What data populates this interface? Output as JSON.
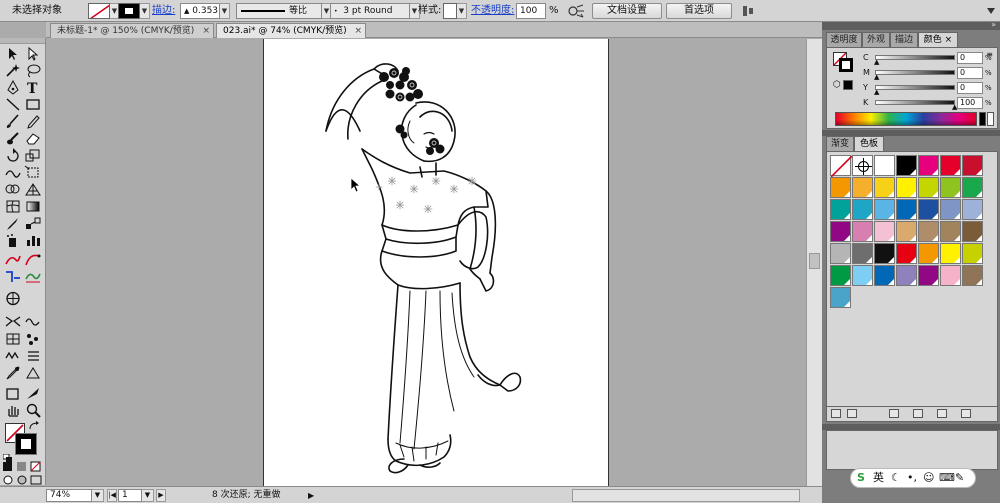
{
  "control_bar": {
    "selection_label": "未选择对象",
    "stroke_label": "描边:",
    "stroke_weight": "0.353",
    "stroke_profile": "等比",
    "brush": "3 pt Round",
    "style_label": "样式:",
    "opacity_label": "不透明度:",
    "opacity_value": "100",
    "opacity_unit": "%",
    "doc_setup_button": "文档设置",
    "preferences_button": "首选项"
  },
  "tabs": [
    {
      "label": "未标题-1* @ 150% (CMYK/预览)",
      "close": "×",
      "active": false
    },
    {
      "label": "023.ai* @ 74% (CMYK/预览)",
      "close": "×",
      "active": true
    }
  ],
  "status_bar": {
    "zoom": "74%",
    "artboard_number": "1",
    "undo_info": "8 次还原; 无重做"
  },
  "color_panel": {
    "tabs": [
      "透明度",
      "外观",
      "描边",
      "颜色"
    ],
    "active_tab": "颜色",
    "channels": [
      {
        "name": "C",
        "value": "0",
        "unit": "%"
      },
      {
        "name": "M",
        "value": "0",
        "unit": "%"
      },
      {
        "name": "Y",
        "value": "0",
        "unit": "%"
      },
      {
        "name": "K",
        "value": "100",
        "unit": "%"
      }
    ]
  },
  "swatch_panel": {
    "tabs": [
      "渐变",
      "色板"
    ],
    "active_tab": "色板",
    "swatches": [
      "none",
      "registration",
      "#ffffff",
      "#000000",
      "#e6007e",
      "#e4002b",
      "#c8102e",
      "#f39800",
      "#f6ae2d",
      "#f7d117",
      "#fff100",
      "#c3d600",
      "#8fc31f",
      "#1aa84d",
      "#00a29a",
      "#1fa5c6",
      "#5ab4e5",
      "#0068b7",
      "#1e50a2",
      "#7e95c6",
      "#9db1d9",
      "#920783",
      "#d67fb0",
      "#f4c0d4",
      "#d9a96d",
      "#b08d6a",
      "#a1845c",
      "#7a5c38",
      "#b5b5b5",
      "#6e6e6e",
      "#111111",
      "#e60012",
      "#f39800",
      "#fff100",
      "#c7d100",
      "#009944",
      "#7ecef4",
      "#0068b7",
      "#8f82bc",
      "#920783",
      "#f5b2c8",
      "#8f7458",
      "#4aa3c9"
    ]
  },
  "ime": {
    "lang_label": "英"
  }
}
